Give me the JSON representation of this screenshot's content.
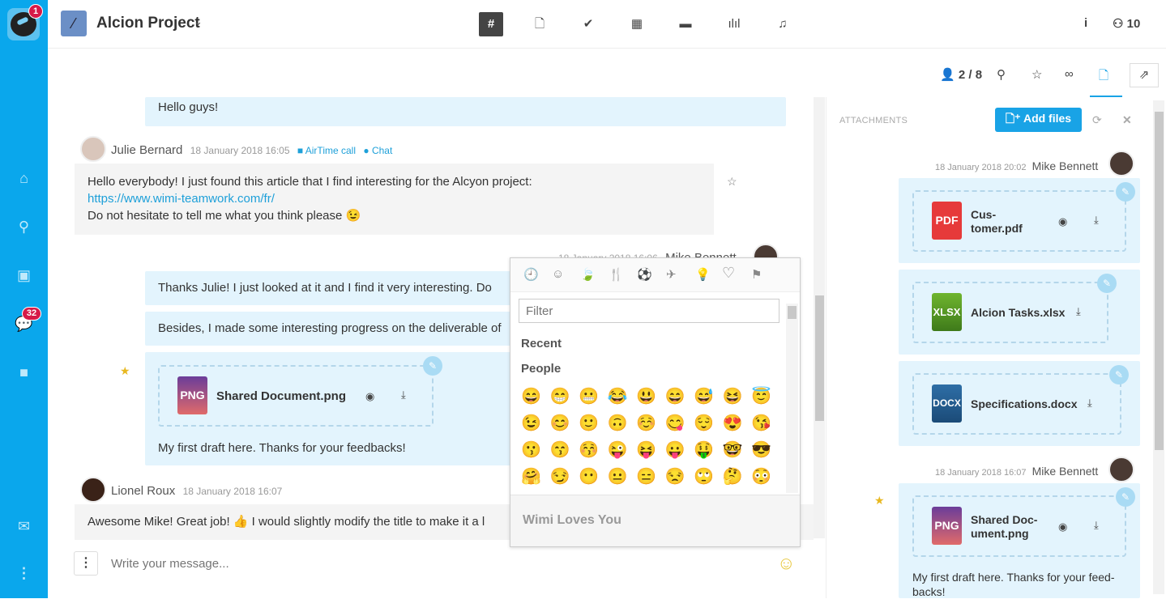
{
  "app": {
    "notification_count": "1",
    "messages_badge": "32"
  },
  "sidebar": {
    "items": [
      {
        "name": "home",
        "icon": "home-icon"
      },
      {
        "name": "search",
        "icon": "search-icon"
      },
      {
        "name": "contacts",
        "icon": "contacts-icon"
      },
      {
        "name": "messages",
        "icon": "chat-icon"
      },
      {
        "name": "video",
        "icon": "video-icon"
      },
      {
        "name": "mail",
        "icon": "mail-icon"
      },
      {
        "name": "more",
        "icon": "more-vertical-icon"
      }
    ]
  },
  "header": {
    "project_title": "Alcion Project",
    "tabs": [
      {
        "name": "channel",
        "glyph": "#",
        "active": true
      },
      {
        "name": "documents",
        "glyph": "🗋"
      },
      {
        "name": "tasks",
        "glyph": "✔"
      },
      {
        "name": "calendar",
        "glyph": "▦"
      },
      {
        "name": "briefcase",
        "glyph": "💼"
      },
      {
        "name": "stats",
        "glyph": "📊"
      },
      {
        "name": "notifications",
        "glyph": "🔔"
      }
    ],
    "info_glyph": "i",
    "members_count": "10"
  },
  "subbar": {
    "online_count": "2 / 8"
  },
  "chat": {
    "messages": [
      {
        "text": "Hello guys!"
      },
      {
        "author": "Julie Bernard",
        "time": "18 January 2018 16:05",
        "airtime_label": "AirTime call",
        "chat_label": "Chat",
        "line1": "Hello everybody! I just found this article that I find interesting for the Alcyon project:",
        "link": "https://www.wimi-teamwork.com/fr/",
        "line3": "Do not hesitate to tell me what you think please 😉"
      },
      {
        "author": "Mike Bennett",
        "time": "18 January 2018 16:06",
        "line1": "Thanks Julie! I just looked at it and I find it very interesting. Do",
        "line2": "Besides, I made some interesting progress on the deliverable of",
        "file_name": "Shared Document.png",
        "file_type": "PNG",
        "caption": "My first draft here. Thanks for your feedbacks!"
      },
      {
        "author": "Lionel Roux",
        "time": "18 January 2018 16:07",
        "text": "Awesome Mike!  Great job! 👍 I would slightly modify the title to make it a l"
      }
    ],
    "composer_placeholder": "Write your message..."
  },
  "emoji_picker": {
    "categories": [
      "🕘",
      "☺",
      "🍃",
      "🍴",
      "⚽",
      "✈",
      "💡",
      "♡",
      "⚑"
    ],
    "filter_placeholder": "Filter",
    "section_recent": "Recent",
    "section_people": "People",
    "emojis": [
      "😄",
      "😁",
      "😬",
      "😂",
      "😃",
      "😄",
      "😅",
      "😆",
      "😇",
      "😉",
      "😊",
      "🙂",
      "🙃",
      "☺️",
      "😋",
      "😌",
      "😍",
      "😘",
      "😗",
      "😙",
      "😚",
      "😜",
      "😝",
      "😛",
      "🤑",
      "🤓",
      "😎",
      "🤗",
      "😏",
      "😶",
      "😐",
      "😑",
      "😒",
      "🙄",
      "🤔",
      "😳"
    ],
    "footer_text": "Wimi Loves You"
  },
  "attachments": {
    "title": "ATTACHMENTS",
    "add_files_label": "Add files",
    "groups": [
      {
        "time": "18 January 2018 20:02",
        "author": "Mike Bennett",
        "files": [
          {
            "type": "PDF",
            "name": "Cus-\ntomer.pdf",
            "preview": true
          },
          {
            "type": "XLSX",
            "name": "Alcion Tasks.xlsx",
            "preview": false
          },
          {
            "type": "DOCX",
            "name": "Specifications.docx",
            "preview": false
          }
        ]
      },
      {
        "time": "18 January 2018 16:07",
        "author": "Mike Bennett",
        "files": [
          {
            "type": "PNG",
            "name": "Shared Doc-\nument.png",
            "preview": true
          }
        ],
        "caption": "My first draft here. Thanks for your feed-backs!"
      }
    ]
  },
  "colors": {
    "sidebar": "#0aa7ec",
    "accent": "#19a3e6",
    "badge": "#d61a48",
    "bubble": "#e3f4fd",
    "star": "#e8b820"
  }
}
